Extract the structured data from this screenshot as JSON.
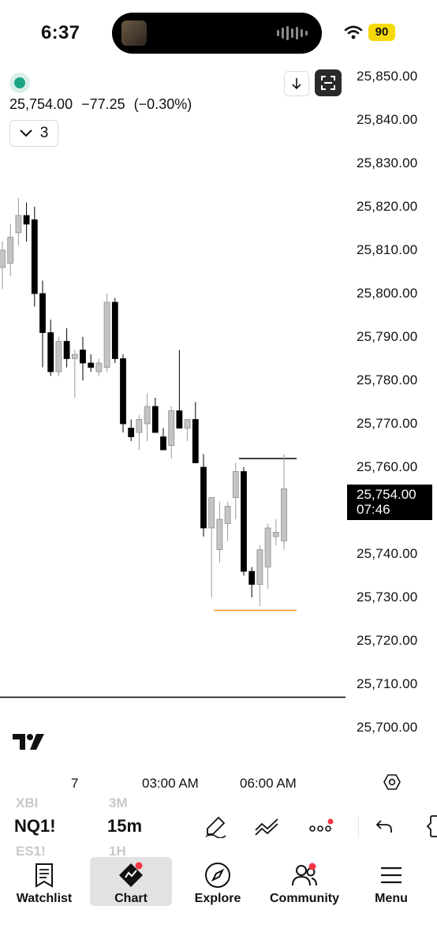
{
  "status_bar": {
    "time": "6:37",
    "battery": "90"
  },
  "header": {
    "last_price": "25,754.00",
    "change": "−77.25",
    "change_pct": "(−0.30%)",
    "indicator_count": "3"
  },
  "price_axis": {
    "labels": [
      "25,850.00",
      "25,840.00",
      "25,830.00",
      "25,820.00",
      "25,810.00",
      "25,800.00",
      "25,790.00",
      "25,780.00",
      "25,770.00",
      "25,760.00",
      "25,740.00",
      "25,730.00",
      "25,720.00",
      "25,710.00",
      "25,700.00"
    ],
    "last_price": "25,754.00",
    "countdown": "07:46"
  },
  "time_axis": {
    "labels": [
      "7",
      "03:00 AM",
      "06:00 AM"
    ]
  },
  "chart_data": {
    "type": "candlestick",
    "symbol": "NQ1!",
    "interval": "15m",
    "ylim": [
      25695,
      25855
    ],
    "candles": [
      {
        "o": 25806,
        "h": 25812,
        "l": 25801,
        "c": 25810
      },
      {
        "o": 25807,
        "h": 25816,
        "l": 25804,
        "c": 25813
      },
      {
        "o": 25814,
        "h": 25822,
        "l": 25811,
        "c": 25818
      },
      {
        "o": 25818,
        "h": 25821,
        "l": 25812,
        "c": 25816
      },
      {
        "o": 25817,
        "h": 25820,
        "l": 25797,
        "c": 25800
      },
      {
        "o": 25800,
        "h": 25803,
        "l": 25783,
        "c": 25791
      },
      {
        "o": 25791,
        "h": 25794,
        "l": 25781,
        "c": 25782
      },
      {
        "o": 25782,
        "h": 25790,
        "l": 25781,
        "c": 25789
      },
      {
        "o": 25789,
        "h": 25792,
        "l": 25783,
        "c": 25785
      },
      {
        "o": 25785,
        "h": 25787,
        "l": 25776,
        "c": 25786
      },
      {
        "o": 25787,
        "h": 25790,
        "l": 25780,
        "c": 25784
      },
      {
        "o": 25784,
        "h": 25786,
        "l": 25782,
        "c": 25783
      },
      {
        "o": 25782,
        "h": 25785,
        "l": 25781,
        "c": 25784
      },
      {
        "o": 25783,
        "h": 25800,
        "l": 25782,
        "c": 25798
      },
      {
        "o": 25798,
        "h": 25799,
        "l": 25784,
        "c": 25785
      },
      {
        "o": 25785,
        "h": 25786,
        "l": 25768,
        "c": 25770
      },
      {
        "o": 25769,
        "h": 25771,
        "l": 25766,
        "c": 25767
      },
      {
        "o": 25768,
        "h": 25772,
        "l": 25764,
        "c": 25771
      },
      {
        "o": 25770,
        "h": 25777,
        "l": 25766,
        "c": 25774
      },
      {
        "o": 25774,
        "h": 25776,
        "l": 25770,
        "c": 25768
      },
      {
        "o": 25767,
        "h": 25769,
        "l": 25765,
        "c": 25764
      },
      {
        "o": 25765,
        "h": 25774,
        "l": 25762,
        "c": 25773
      },
      {
        "o": 25773,
        "h": 25787,
        "l": 25769,
        "c": 25769
      },
      {
        "o": 25769,
        "h": 25771,
        "l": 25766,
        "c": 25771
      },
      {
        "o": 25771,
        "h": 25775,
        "l": 25764,
        "c": 25761
      },
      {
        "o": 25760,
        "h": 25763,
        "l": 25744,
        "c": 25746
      },
      {
        "o": 25746,
        "h": 25748,
        "l": 25730,
        "c": 25753
      },
      {
        "o": 25741,
        "h": 25752,
        "l": 25738,
        "c": 25748
      },
      {
        "o": 25747,
        "h": 25752,
        "l": 25743,
        "c": 25751
      },
      {
        "o": 25753,
        "h": 25761,
        "l": 25748,
        "c": 25759
      },
      {
        "o": 25759,
        "h": 25760,
        "l": 25735,
        "c": 25736
      },
      {
        "o": 25736,
        "h": 25737,
        "l": 25730,
        "c": 25733
      },
      {
        "o": 25733,
        "h": 25742,
        "l": 25728,
        "c": 25741
      },
      {
        "o": 25737,
        "h": 25747,
        "l": 25732,
        "c": 25746
      },
      {
        "o": 25744,
        "h": 25748,
        "l": 25742,
        "c": 25745
      },
      {
        "o": 25743,
        "h": 25763,
        "l": 25741,
        "c": 25755
      }
    ],
    "levels": [
      {
        "price": 25762,
        "color": "#000000"
      },
      {
        "price": 25727,
        "color": "#f7931a"
      },
      {
        "price": 25707,
        "color": "#000000"
      }
    ],
    "up_color": "#c4c4c4",
    "down_color": "#000000"
  },
  "toolbar": {
    "symbol": "NQ1!",
    "symbol_above": "XBI",
    "symbol_below": "ES1!",
    "interval": "15m",
    "interval_above": "3M",
    "interval_below": "1H"
  },
  "nav": {
    "items": [
      {
        "label": "Watchlist",
        "icon": "watchlist-icon"
      },
      {
        "label": "Chart",
        "icon": "chart-icon"
      },
      {
        "label": "Explore",
        "icon": "compass-icon"
      },
      {
        "label": "Community",
        "icon": "community-icon"
      },
      {
        "label": "Menu",
        "icon": "menu-icon"
      }
    ],
    "active": "Chart"
  }
}
